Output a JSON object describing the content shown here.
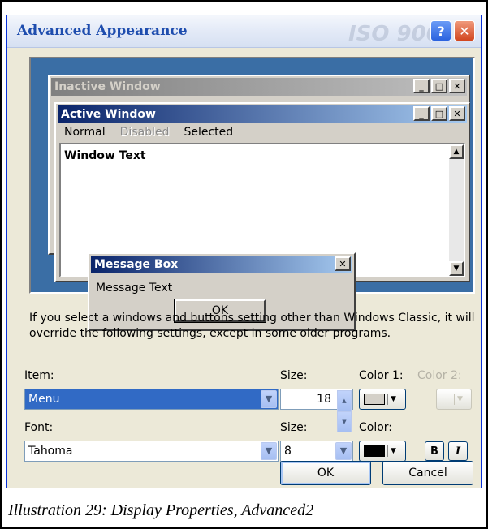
{
  "dialog": {
    "title": "Advanced Appearance",
    "watermark": "ISO 900",
    "help_glyph": "?",
    "close_glyph": "✕"
  },
  "preview": {
    "inactive_title": "Inactive Window",
    "active_title": "Active Window",
    "menu": {
      "normal": "Normal",
      "disabled": "Disabled",
      "selected": "Selected"
    },
    "window_text": "Window Text",
    "message_box_title": "Message Box",
    "message_text": "Message Text",
    "ok": "OK",
    "minimize_glyph": "_",
    "maximize_glyph": "□",
    "close_glyph": "✕"
  },
  "info_text": "If you select a windows and buttons setting other than Windows Classic, it will override the following settings, except in some older programs.",
  "item": {
    "label": "Item:",
    "value": "Menu",
    "size_label": "Size:",
    "size_value": "18",
    "color1_label": "Color 1:",
    "color1": "#d4d0c8",
    "color2_label": "Color 2:"
  },
  "font": {
    "label": "Font:",
    "value": "Tahoma",
    "size_label": "Size:",
    "size_value": "8",
    "color_label": "Color:",
    "color": "#000000",
    "bold": "B",
    "italic": "I"
  },
  "buttons": {
    "ok": "OK",
    "cancel": "Cancel"
  },
  "caption": "Illustration 29: Display Properties, Advanced2"
}
